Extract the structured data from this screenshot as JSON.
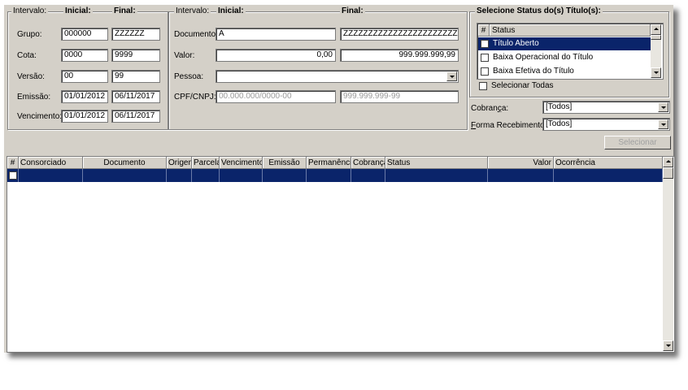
{
  "left_group": {
    "title": "Intervalo:",
    "col_initial": "Inicial:",
    "col_final": "Final:",
    "rows": [
      {
        "label": "Grupo:",
        "initial": "000000",
        "final": "ZZZZZZ"
      },
      {
        "label": "Cota:",
        "initial": "0000",
        "final": "9999"
      },
      {
        "label": "Versão:",
        "initial": "00",
        "final": "99"
      },
      {
        "label": "Emissão:",
        "initial": "01/01/2012",
        "final": "06/11/2017"
      },
      {
        "label": "Vencimento:",
        "initial": "01/01/2012",
        "final": "06/11/2017"
      }
    ]
  },
  "mid_group": {
    "title": "Intervalo:",
    "col_initial": "Inicial:",
    "col_final": "Final:",
    "documento_label": "Documento:",
    "documento_initial": "A",
    "documento_final": "ZZZZZZZZZZZZZZZZZZZZZZZZZ",
    "valor_label": "Valor:",
    "valor_initial": "0,00",
    "valor_final": "999.999.999,99",
    "pessoa_label": "Pessoa:",
    "pessoa_value": "",
    "cpf_label": "CPF/CNPJ:",
    "cpf_initial_placeholder": "00.000.000/0000-00",
    "cpf_final_placeholder": "999.999.999-99"
  },
  "status_group": {
    "title": "Selecione Status do(s) Título(s):",
    "col_hash": "#",
    "col_status": "Status",
    "items": [
      "Título Aberto",
      "Baixa Operacional do Título",
      "Baixa Efetiva do Título"
    ],
    "select_all": "Selecionar Todas"
  },
  "cobranca": {
    "label_prefix": "Cobran",
    "label_underline": "ç",
    "label_suffix": "a:",
    "value": "[Todos]"
  },
  "forma": {
    "label_underline": "F",
    "label_rest": "orma Recebimento:",
    "value": "[Todos]"
  },
  "selecionar_button": "Selecionar",
  "grid": {
    "columns": [
      "#",
      "Consorciado",
      "Documento",
      "Origem",
      "Parcela",
      "Vencimento",
      "Emissão",
      "Permanência",
      "Cobrança",
      "Status",
      "Valor",
      "Ocorrência"
    ]
  },
  "colors": {
    "face": "#d4d0c8",
    "selection": "#0a246a"
  }
}
